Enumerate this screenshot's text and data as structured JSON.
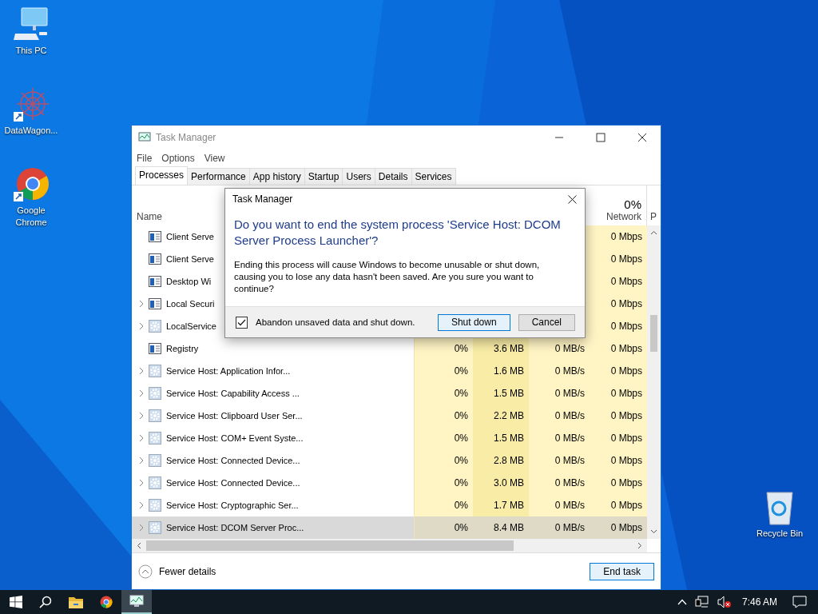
{
  "desktop_icons": [
    {
      "label": "This PC",
      "kind": "pc"
    },
    {
      "label": "DataWagon...",
      "kind": "app"
    },
    {
      "label": "Google Chrome",
      "kind": "browser"
    },
    {
      "label": "Recycle Bin",
      "kind": "bin"
    }
  ],
  "window": {
    "title": "Task Manager",
    "menu": [
      "File",
      "Options",
      "View"
    ],
    "tabs": [
      {
        "label": "Processes",
        "selected": true
      },
      {
        "label": "Performance",
        "selected": false
      },
      {
        "label": "App history",
        "selected": false
      },
      {
        "label": "Startup",
        "selected": false
      },
      {
        "label": "Users",
        "selected": false
      },
      {
        "label": "Details",
        "selected": false
      },
      {
        "label": "Services",
        "selected": false
      }
    ],
    "columns": {
      "name": "Name",
      "network_total": "0%",
      "network": "Network",
      "column_6": "P"
    },
    "rows": [
      {
        "name": "Client Serve",
        "kind": "window",
        "expandable": false,
        "selected": false,
        "network": "0 Mbps"
      },
      {
        "name": "Client Serve",
        "kind": "window",
        "expandable": false,
        "selected": false,
        "network": "0 Mbps"
      },
      {
        "name": "Desktop Wi",
        "kind": "window",
        "expandable": false,
        "selected": false,
        "network": "0 Mbps"
      },
      {
        "name": "Local Securi",
        "kind": "window",
        "expandable": true,
        "selected": false,
        "network": "0 Mbps"
      },
      {
        "name": "LocalService",
        "kind": "gear",
        "expandable": true,
        "selected": false,
        "network": "0 Mbps"
      },
      {
        "name": "Registry",
        "kind": "window",
        "expandable": false,
        "selected": false,
        "cpu": "0%",
        "memory": "3.6 MB",
        "disk": "0 MB/s",
        "network": "0 Mbps"
      },
      {
        "name": "Service Host: Application Infor...",
        "kind": "gear",
        "expandable": true,
        "selected": false,
        "cpu": "0%",
        "memory": "1.6 MB",
        "disk": "0 MB/s",
        "network": "0 Mbps"
      },
      {
        "name": "Service Host: Capability Access ...",
        "kind": "gear",
        "expandable": true,
        "selected": false,
        "cpu": "0%",
        "memory": "1.5 MB",
        "disk": "0 MB/s",
        "network": "0 Mbps"
      },
      {
        "name": "Service Host: Clipboard User Ser...",
        "kind": "gear",
        "expandable": true,
        "selected": false,
        "cpu": "0%",
        "memory": "2.2 MB",
        "disk": "0 MB/s",
        "network": "0 Mbps"
      },
      {
        "name": "Service Host: COM+ Event Syste...",
        "kind": "gear",
        "expandable": true,
        "selected": false,
        "cpu": "0%",
        "memory": "1.5 MB",
        "disk": "0 MB/s",
        "network": "0 Mbps"
      },
      {
        "name": "Service Host: Connected Device...",
        "kind": "gear",
        "expandable": true,
        "selected": false,
        "cpu": "0%",
        "memory": "2.8 MB",
        "disk": "0 MB/s",
        "network": "0 Mbps"
      },
      {
        "name": "Service Host: Connected Device...",
        "kind": "gear",
        "expandable": true,
        "selected": false,
        "cpu": "0%",
        "memory": "3.0 MB",
        "disk": "0 MB/s",
        "network": "0 Mbps"
      },
      {
        "name": "Service Host: Cryptographic Ser...",
        "kind": "gear",
        "expandable": true,
        "selected": false,
        "cpu": "0%",
        "memory": "1.7 MB",
        "disk": "0 MB/s",
        "network": "0 Mbps"
      },
      {
        "name": "Service Host: DCOM Server Proc...",
        "kind": "gear",
        "expandable": true,
        "selected": true,
        "cpu": "0%",
        "memory": "8.4 MB",
        "disk": "0 MB/s",
        "network": "0 Mbps"
      }
    ],
    "footer": {
      "toggle": "Fewer details",
      "button": "End task"
    }
  },
  "dialog": {
    "title": "Task Manager",
    "heading": "Do you want to end the system process 'Service Host: DCOM Server Process Launcher'?",
    "body": "Ending this process will cause Windows to become unusable or shut down, causing you to lose any data hasn't been saved. Are you sure you want to continue?",
    "checkbox": {
      "label": "Abandon unsaved data and shut down.",
      "checked": true
    },
    "buttons": [
      {
        "label": "Shut down",
        "default": true
      },
      {
        "label": "Cancel",
        "default": false
      }
    ]
  },
  "taskbar": {
    "apps": [
      {
        "kind": "search",
        "active": false
      },
      {
        "kind": "folder",
        "active": false
      },
      {
        "kind": "browser",
        "active": false
      },
      {
        "kind": "monitor",
        "active": true
      }
    ],
    "time": "7:46 AM"
  }
}
